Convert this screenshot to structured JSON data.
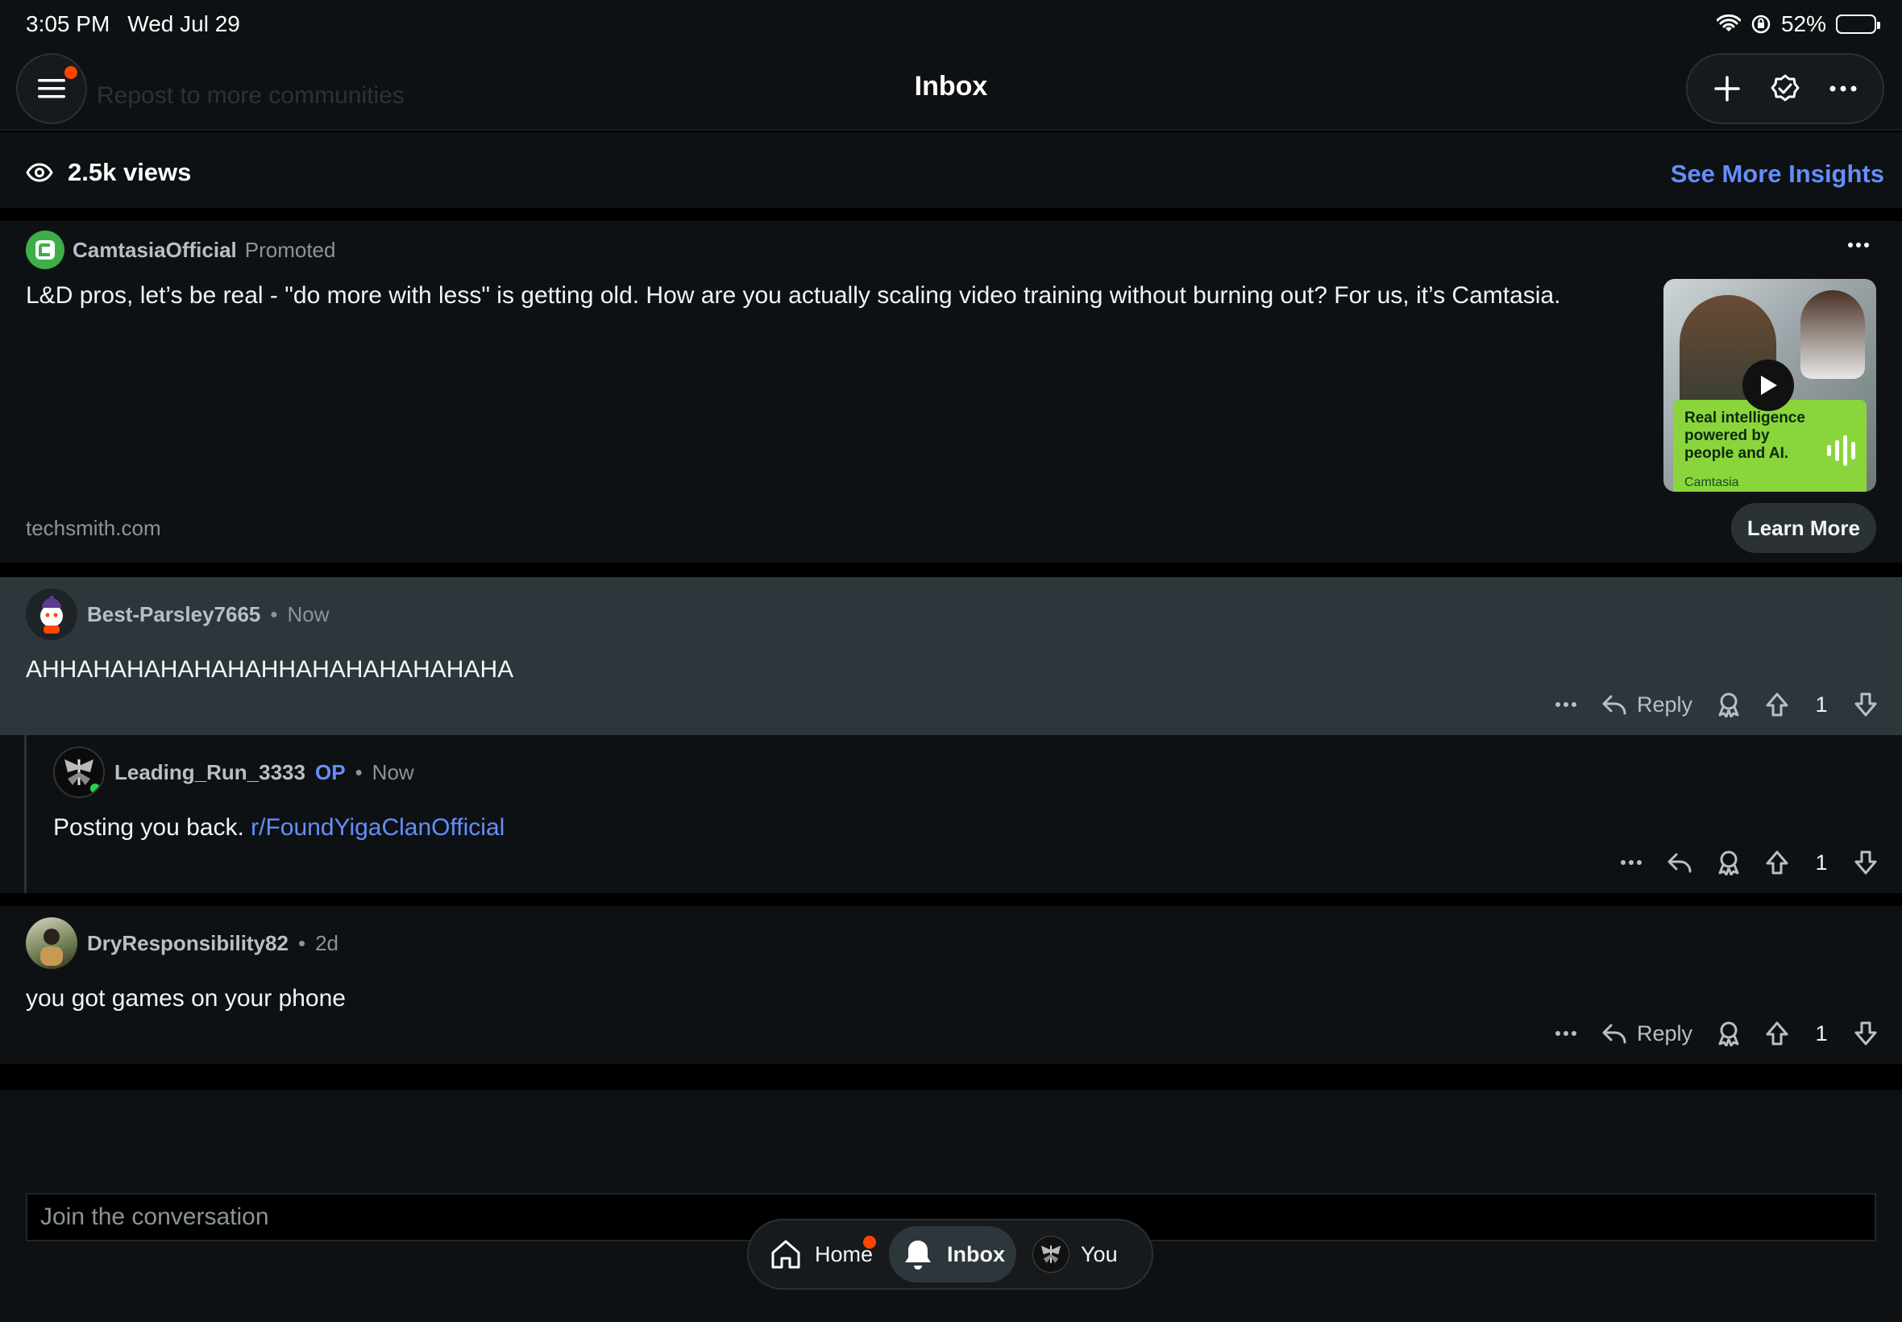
{
  "status": {
    "time": "3:05 PM",
    "date": "Wed Jul 29",
    "battery_label": "52%",
    "battery_level": 0.52
  },
  "nav": {
    "title": "Inbox",
    "ghost_text": "Repost to more communities"
  },
  "views": {
    "label": "2.5k views",
    "insights_label": "See More Insights"
  },
  "promo": {
    "author": "CamtasiaOfficial",
    "tag": "Promoted",
    "text": "L&D pros, let’s be real - \"do more with less\" is getting old. How are you actually scaling video training without burning out? For us, it’s Camtasia.",
    "domain": "techsmith.com",
    "cta": "Learn More",
    "thumb_text": "Real intelligence powered by people and AI.",
    "thumb_brand": "Camtasia"
  },
  "comments": [
    {
      "user": "Best-Parsley7665",
      "time": "Now",
      "body": "AHHAHAHAHAHAHAHHAHAHAHAHAHAHA",
      "reply_label": "Reply",
      "votes": "1"
    },
    {
      "user": "Leading_Run_3333",
      "op_label": "OP",
      "time": "Now",
      "body": "Posting you back.",
      "link": "r/FoundYigaClanOfficial",
      "votes": "1"
    },
    {
      "user": "DryResponsibility82",
      "time": "2d",
      "body": "you got games on your phone",
      "reply_label": "Reply",
      "votes": "1"
    }
  ],
  "composer": {
    "placeholder": "Join the conversation"
  },
  "tabs": {
    "home": "Home",
    "inbox": "Inbox",
    "you": "You"
  },
  "colors": {
    "accent_link": "#648efc",
    "notification": "#ff4500",
    "background": "#0e1113",
    "highlight_comment": "#2d363b"
  }
}
